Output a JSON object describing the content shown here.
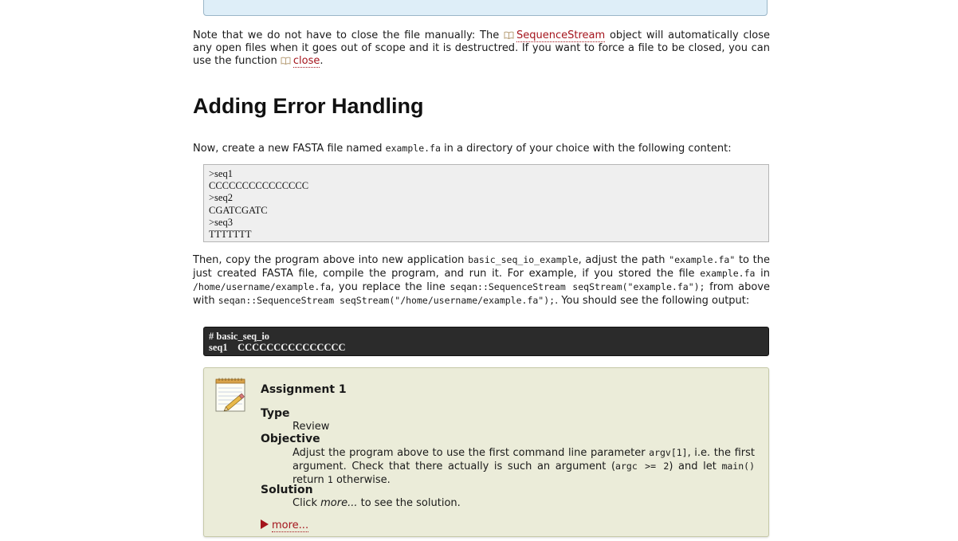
{
  "note": {
    "text_before": "Note that we do not have to close the file manually: The ",
    "link1": "SequenceStream",
    "text_middle": " object will automatically close any open files when it goes out of scope and it is destructred. If you want to force a file to be closed, you can use the function ",
    "link2": "close",
    "text_after": "."
  },
  "heading": "Adding Error Handling",
  "intro": {
    "before": "Now, create a new FASTA file named ",
    "code": "example.fa",
    "after": " in a directory of your choice with the following content:"
  },
  "fasta_lines": [
    ">seq1",
    "CCCCCCCCCCCCCCC",
    ">seq2",
    "CGATCGATC",
    ">seq3",
    "TTTTTTT"
  ],
  "instructions": {
    "t1": "Then, copy the program above into new application ",
    "c1": "basic_seq_io_example",
    "t2": ", adjust the path ",
    "c2": "\"example.fa\"",
    "t3": " to the just created FASTA file, compile the program, and run it. For example, if you stored the file ",
    "c3": "example.fa",
    "t4": " in ",
    "c4": "/home/username/example.fa",
    "t5": ", you replace the line ",
    "c5": "seqan::SequenceStream seqStream(\"example.fa\");",
    "t6": " from above with ",
    "c6": "seqan::SequenceStream seqStream(\"/home/username/example.fa\");",
    "t7": ". You should see the following output:"
  },
  "console_lines": [
    "# basic_seq_io",
    "seq1    CCCCCCCCCCCCCCC"
  ],
  "assignment": {
    "title": "Assignment 1",
    "type_label": "Type",
    "type_value": "Review",
    "objective_label": "Objective",
    "objective": {
      "t1": "Adjust the program above to use the first command line parameter ",
      "c1": "argv[1]",
      "t2": ", i.e. the first argument. Check that there actually is such an argument (",
      "c2": "argc >= 2",
      "t3": ") and let ",
      "c3": "main()",
      "t4": " return ",
      "c4": "1",
      "t5": " otherwise."
    },
    "solution_label": "Solution",
    "solution": {
      "t1": "Click ",
      "em": "more...",
      "t2": " to see the solution."
    },
    "more_link": "more..."
  },
  "colors": {
    "link": "#a4141c",
    "top_box_bg": "#deeef8",
    "code_box_bg": "#efefef",
    "console_bg": "#2b2b2b",
    "assignment_bg": "#ebecd9"
  }
}
